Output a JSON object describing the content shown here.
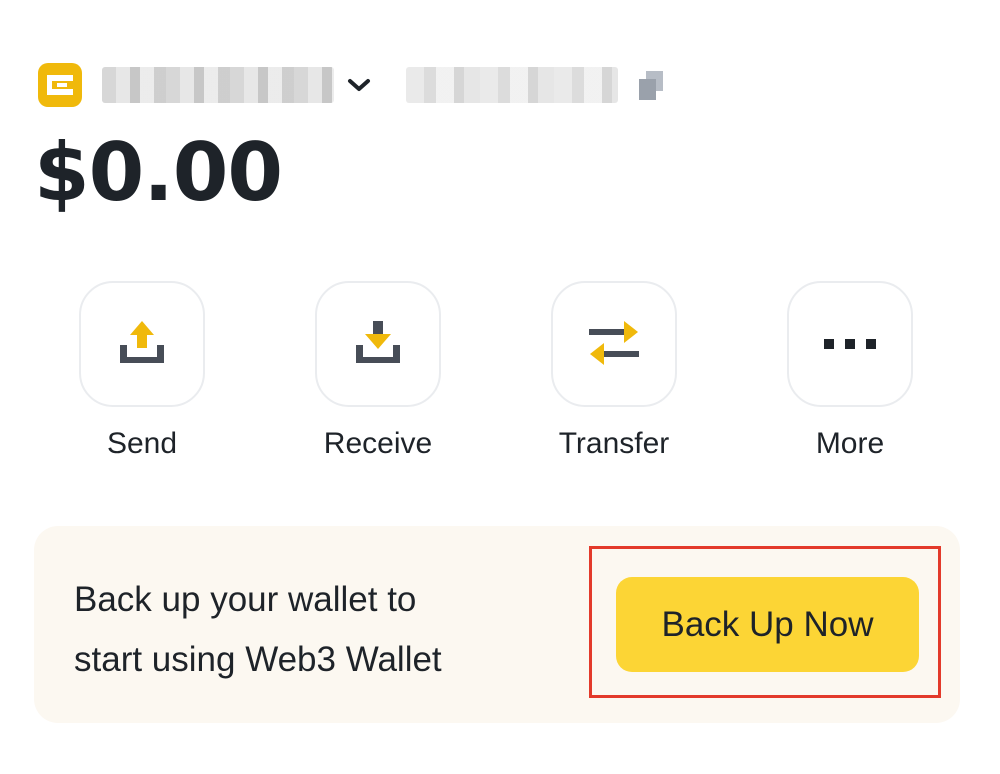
{
  "header": {
    "wallet_icon": "wallet-logo-icon",
    "wallet_name_blurred": true,
    "dropdown_icon": "chevron-down-icon",
    "address_blurred": true,
    "copy_icon": "copy-icon"
  },
  "balance": "$0.00",
  "actions": [
    {
      "label": "Send",
      "icon": "send-upload-icon"
    },
    {
      "label": "Receive",
      "icon": "receive-download-icon"
    },
    {
      "label": "Transfer",
      "icon": "transfer-arrows-icon"
    },
    {
      "label": "More",
      "icon": "more-dots-icon"
    }
  ],
  "banner": {
    "text_line1": "Back up your wallet to",
    "text_line2": "start using Web3 Wallet",
    "button_label": "Back Up Now"
  },
  "colors": {
    "accent": "#FCD535",
    "icon_yellow": "#F0B90B",
    "text": "#1E2329",
    "icon_dark": "#474D57",
    "banner_bg": "#FCF8F1",
    "highlight_border": "#E33A2B"
  }
}
